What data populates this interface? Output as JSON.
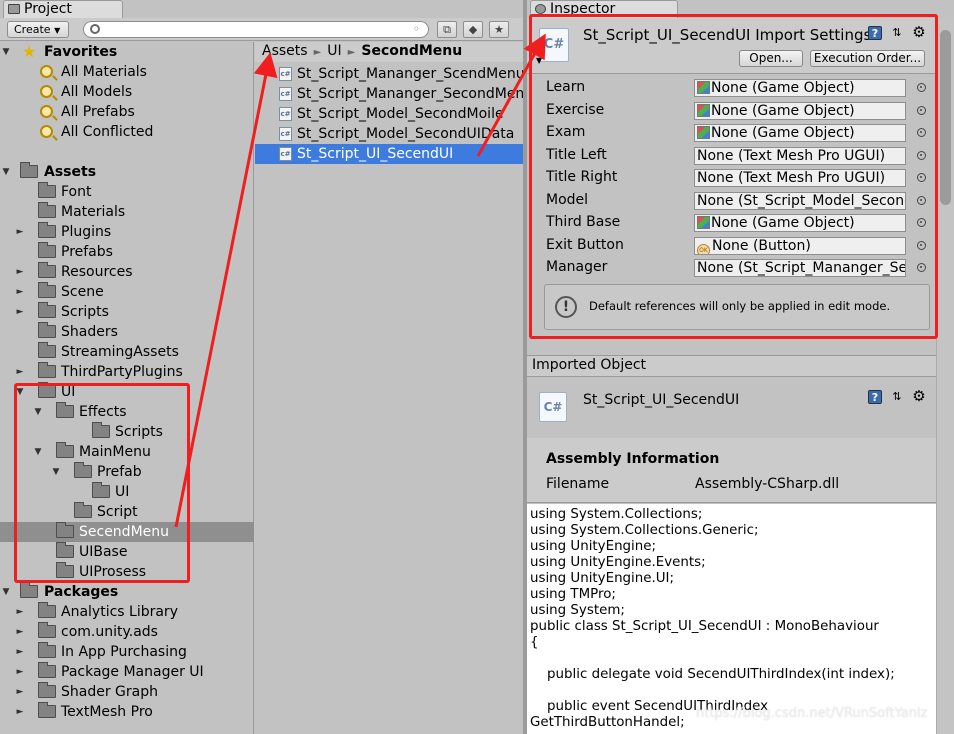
{
  "project_tab": {
    "label": "Project"
  },
  "inspector_tab": {
    "label": "Inspector"
  },
  "project_toolbar": {
    "create_label": "Create",
    "search_placeholder": ""
  },
  "tree": [
    {
      "name": "Favorites",
      "kind": "section"
    },
    {
      "name": "All Materials",
      "kind": "saved-search"
    },
    {
      "name": "All Models",
      "kind": "saved-search"
    },
    {
      "name": "All Prefabs",
      "kind": "saved-search"
    },
    {
      "name": "All Conflicted",
      "kind": "saved-search"
    },
    {
      "name": "Assets",
      "kind": "section"
    },
    {
      "name": "Font"
    },
    {
      "name": "Materials"
    },
    {
      "name": "Plugins"
    },
    {
      "name": "Prefabs"
    },
    {
      "name": "Resources"
    },
    {
      "name": "Scene"
    },
    {
      "name": "Scripts"
    },
    {
      "name": "Shaders"
    },
    {
      "name": "StreamingAssets"
    },
    {
      "name": "ThirdPartyPlugins"
    },
    {
      "name": "UI"
    },
    {
      "name": "Effects"
    },
    {
      "name": "Scripts"
    },
    {
      "name": "MainMenu"
    },
    {
      "name": "Prefab"
    },
    {
      "name": "UI"
    },
    {
      "name": "Script"
    },
    {
      "name": "SecendMenu",
      "selected": true
    },
    {
      "name": "UIBase"
    },
    {
      "name": "UIProsess"
    },
    {
      "name": "Packages",
      "kind": "section"
    },
    {
      "name": "Analytics Library"
    },
    {
      "name": "com.unity.ads"
    },
    {
      "name": "In App Purchasing"
    },
    {
      "name": "Package Manager UI"
    },
    {
      "name": "Shader Graph"
    },
    {
      "name": "TextMesh Pro"
    }
  ],
  "breadcrumb": [
    "Assets",
    "UI",
    "SecondMenu"
  ],
  "files": [
    "St_Script_Mananger_ScendMenu",
    "St_Script_Mananger_SecondMenu",
    "St_Script_Model_SecondMoile",
    "St_Script_Model_SecondUIData",
    "St_Script_UI_SecendUI"
  ],
  "selected_file_index": 4,
  "inspector": {
    "icon_text": "C#",
    "title": "St_Script_UI_SecendUI Import Settings",
    "open_label": "Open...",
    "exec_order_label": "Execution Order...",
    "properties": [
      {
        "label": "Learn",
        "value": "None (Game Object)",
        "icon": "gameobject"
      },
      {
        "label": "Exercise",
        "value": "None (Game Object)",
        "icon": "gameobject"
      },
      {
        "label": "Exam",
        "value": "None (Game Object)",
        "icon": "gameobject"
      },
      {
        "label": "Title Left",
        "value": "None (Text Mesh Pro UGUI)",
        "icon": ""
      },
      {
        "label": "Title Right",
        "value": "None (Text Mesh Pro UGUI)",
        "icon": ""
      },
      {
        "label": "Model",
        "value": "None (St_Script_Model_SecondMoile)",
        "icon": ""
      },
      {
        "label": "Third Base",
        "value": "None (Game Object)",
        "icon": "gameobject"
      },
      {
        "label": "Exit Button",
        "value": "None (Button)",
        "icon": "button"
      },
      {
        "label": "Manager",
        "value": "None (St_Script_Mananger_SecondMenu)",
        "icon": ""
      }
    ],
    "help_message": "Default references will only be applied in edit mode.",
    "imported_label": "Imported Object",
    "imported_title": "St_Script_UI_SecendUI",
    "assembly_title": "Assembly Information",
    "filename_label": "Filename",
    "filename_value": "Assembly-CSharp.dll",
    "code": "using System.Collections;\nusing System.Collections.Generic;\nusing UnityEngine;\nusing UnityEngine.Events;\nusing UnityEngine.UI;\nusing TMPro;\nusing System;\npublic class St_Script_UI_SecendUI : MonoBehaviour\n{\n\n    public delegate void SecendUIThirdIndex(int index);\n\n    public event SecendUIThirdIndex\nGetThirdButtonHandel;"
  },
  "watermark": "https://blog.csdn.net/VRunSoftYanlz",
  "colors": {
    "highlight": "#3e7bde",
    "annotation": "#f01e1e",
    "panel": "#c2c2c2"
  }
}
